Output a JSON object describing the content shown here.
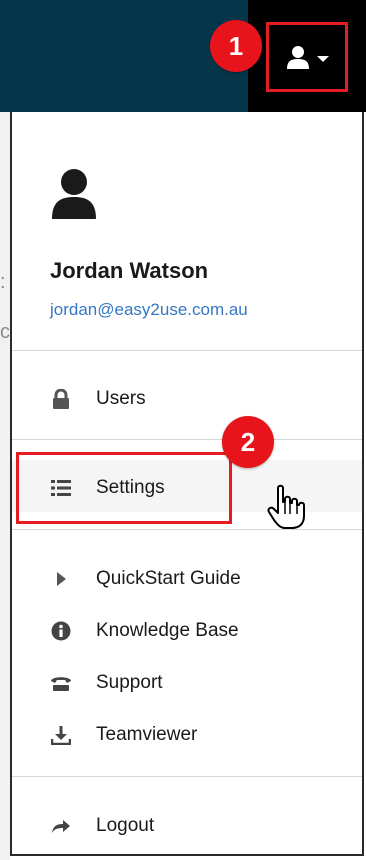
{
  "callouts": {
    "first": "1",
    "second": "2"
  },
  "profile": {
    "name": "Jordan Watson",
    "email": "jordan@easy2use.com.au"
  },
  "menu": {
    "users": "Users",
    "settings": "Settings",
    "quickstart": "QuickStart Guide",
    "knowledge_base": "Knowledge Base",
    "support": "Support",
    "teamviewer": "Teamviewer",
    "logout": "Logout"
  },
  "icons": {
    "user_toggle": "user-icon",
    "users": "lock-icon",
    "settings": "list-icon",
    "quickstart": "play-icon",
    "knowledge_base": "info-icon",
    "support": "phone-icon",
    "teamviewer": "download-icon",
    "logout": "arrow-right-icon"
  },
  "colors": {
    "topbar": "#053548",
    "highlight": "#e51c23",
    "callout": "#e8141c",
    "link": "#3577c4"
  }
}
